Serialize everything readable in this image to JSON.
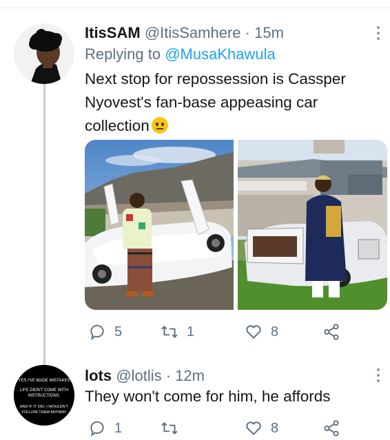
{
  "tweets": [
    {
      "name": "ItisSAM",
      "handle": "@ItisSamhere",
      "dot": "·",
      "time": "15m",
      "reply_prefix": "Replying to",
      "reply_mention": "@MusaKhawula",
      "text_line1": "Next stop for repossession is Cassper",
      "text_line2": "Nyovest's fan-base appeasing car",
      "text_line3": "collection",
      "emoji_icon": "neutral-face-emoji",
      "actions": {
        "replies": "5",
        "retweets": "1",
        "likes": "8"
      }
    },
    {
      "name": "lots",
      "handle": "@lotlis",
      "dot": "·",
      "time": "12m",
      "text_line1": "They won't come for him, he affords",
      "actions": {
        "replies": "1",
        "retweets": "",
        "likes": "8"
      },
      "avatar_text": [
        "YES I'VE MADE MISTAKES",
        "LIFE DIDN'T COME WITH",
        "INSTRUCTIONS.",
        "AND IF IT DID, I WOULDN'T",
        "FOLLOW THEM ANYWAY"
      ]
    }
  ],
  "colors": {
    "text": "#14171a",
    "secondary": "#5b7083",
    "link": "#1da1f2",
    "thread": "#c4cfd6"
  }
}
